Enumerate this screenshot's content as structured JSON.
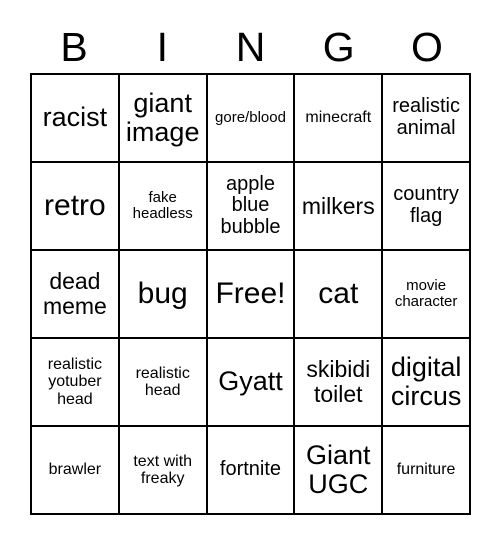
{
  "card": {
    "title": "BINGO",
    "header_letters": [
      "B",
      "I",
      "N",
      "G",
      "O"
    ],
    "free_space_label": "Free!",
    "colors": {
      "background": "#ffffff",
      "grid_line": "#000000",
      "text": "#000000"
    },
    "rows": [
      [
        {
          "text": "racist",
          "size": "lg"
        },
        {
          "text": "giant image",
          "size": "lg"
        },
        {
          "text": "gore/blood",
          "size": "xxs"
        },
        {
          "text": "minecraft",
          "size": "xs"
        },
        {
          "text": "realistic animal",
          "size": "sm"
        }
      ],
      [
        {
          "text": "retro",
          "size": "xl"
        },
        {
          "text": "fake headless",
          "size": "xxs"
        },
        {
          "text": "apple blue bubble",
          "size": "sm"
        },
        {
          "text": "milkers",
          "size": "md"
        },
        {
          "text": "country flag",
          "size": "sm"
        }
      ],
      [
        {
          "text": "dead meme",
          "size": "md"
        },
        {
          "text": "bug",
          "size": "xl"
        },
        {
          "text": "Free!",
          "size": "xl"
        },
        {
          "text": "cat",
          "size": "xl"
        },
        {
          "text": "movie character",
          "size": "xxs"
        }
      ],
      [
        {
          "text": "realistic yotuber head",
          "size": "xs"
        },
        {
          "text": "realistic head",
          "size": "xs"
        },
        {
          "text": "Gyatt",
          "size": "lg"
        },
        {
          "text": "skibidi toilet",
          "size": "md"
        },
        {
          "text": "digital circus",
          "size": "lg"
        }
      ],
      [
        {
          "text": "brawler",
          "size": "xs"
        },
        {
          "text": "text with freaky",
          "size": "xs"
        },
        {
          "text": "fortnite",
          "size": "sm"
        },
        {
          "text": "Giant UGC",
          "size": "lg"
        },
        {
          "text": "furniture",
          "size": "xs"
        }
      ]
    ]
  }
}
